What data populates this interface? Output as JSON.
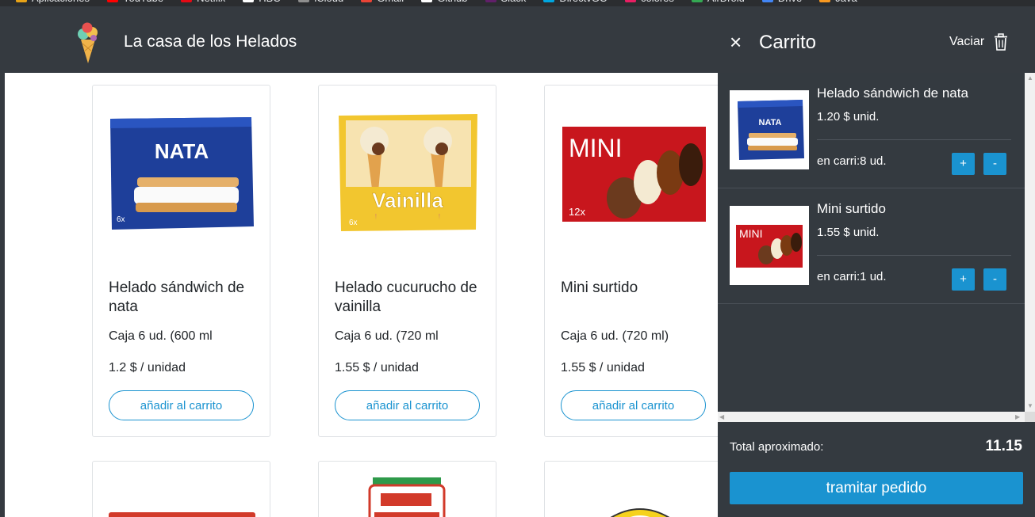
{
  "bookmarks": [
    {
      "label": "Aplicaciones",
      "color": "#e8a317"
    },
    {
      "label": "YouTube",
      "color": "#ff0000"
    },
    {
      "label": "Netflix",
      "color": "#e50914"
    },
    {
      "label": "HBO",
      "color": "#ffffff"
    },
    {
      "label": "iCloud",
      "color": "#8e8e8e"
    },
    {
      "label": "Gmail",
      "color": "#ea4335"
    },
    {
      "label": "Github",
      "color": "#ffffff"
    },
    {
      "label": "Slack",
      "color": "#611f69"
    },
    {
      "label": "DirectvGO",
      "color": "#00a6e0"
    },
    {
      "label": "colores",
      "color": "#e91e63"
    },
    {
      "label": "AirDroid",
      "color": "#34a853"
    },
    {
      "label": "Drive",
      "color": "#4285f4"
    },
    {
      "label": "Java",
      "color": "#f89820"
    }
  ],
  "header": {
    "brand": "La casa de los Helados",
    "logo_icon": "ice-cream-icon",
    "close_symbol": "×",
    "cart_title": "Carrito",
    "clear_label": "Vaciar",
    "clear_icon": "trash-icon"
  },
  "products": [
    {
      "name": "Helado sándwich de nata",
      "desc": "Caja 6 ud. (600 ml",
      "price": "1.2 $ / unidad",
      "button": "añadir al carrito",
      "image": "nata"
    },
    {
      "name": "Helado cucurucho de vainilla",
      "desc": "Caja 6 ud. (720 ml",
      "price": "1.55 $ / unidad",
      "button": "añadir al carrito",
      "image": "vainilla"
    },
    {
      "name": "Mini surtido",
      "desc": "Caja 6 ud. (720 ml)",
      "price": "1.55 $ / unidad",
      "button": "añadir al carrito",
      "image": "mini"
    }
  ],
  "images": {
    "nata_text": "NATA",
    "nata_count": "6x",
    "vainilla_text": "Vainilla",
    "vainilla_count": "6x",
    "mini_text": "MINI",
    "mini_count": "12x"
  },
  "cart": {
    "items": [
      {
        "name": "Helado sándwich de nata",
        "price": "1.20 $ unid.",
        "qty": "en carri:8 ud.",
        "plus": "+",
        "minus": "-"
      },
      {
        "name": "Mini surtido",
        "price": "1.55 $ unid.",
        "qty": "en carri:1 ud.",
        "plus": "+",
        "minus": "-"
      }
    ],
    "total_label": "Total aproximado:",
    "total_value": "11.15",
    "checkout_label": "tramitar pedido"
  },
  "colors": {
    "header_bg": "#353a40",
    "accent": "#1a93d0",
    "cart_bg": "#343a40",
    "nata_box": "#1e3f9a",
    "vainilla_box": "#f2c62f",
    "mini_box": "#c8161d"
  }
}
